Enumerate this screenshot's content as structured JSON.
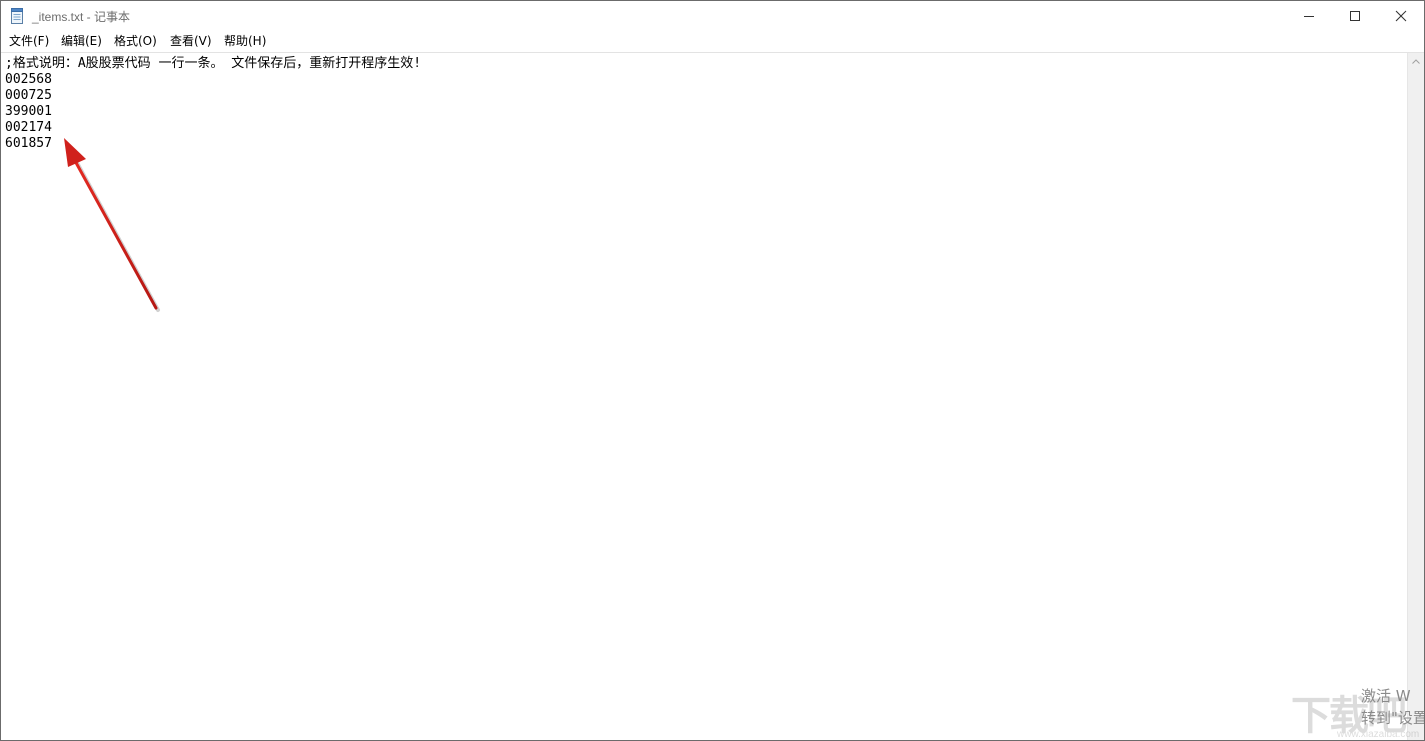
{
  "window": {
    "title": "_items.txt - 记事本",
    "app_icon": "notepad-icon",
    "controls": {
      "minimize_icon": "minimize-icon",
      "maximize_icon": "maximize-icon",
      "close_icon": "close-icon"
    }
  },
  "menu": {
    "items": [
      {
        "label": "文件(F)"
      },
      {
        "label": "编辑(E)"
      },
      {
        "label": "格式(O)"
      },
      {
        "label": "查看(V)"
      },
      {
        "label": "帮助(H)"
      }
    ]
  },
  "editor": {
    "lines": [
      ";格式说明：A股股票代码 一行一条。 文件保存后，重新打开程序生效!",
      "002568",
      "000725",
      "399001",
      "002174",
      "601857"
    ]
  },
  "annotation": {
    "arrow_color": "#d0211c"
  },
  "watermark": {
    "main": "下载吧",
    "sub": "www.xiazaiba.com"
  },
  "activation": {
    "line1": "激活 W",
    "line2": "转到\"设置"
  }
}
